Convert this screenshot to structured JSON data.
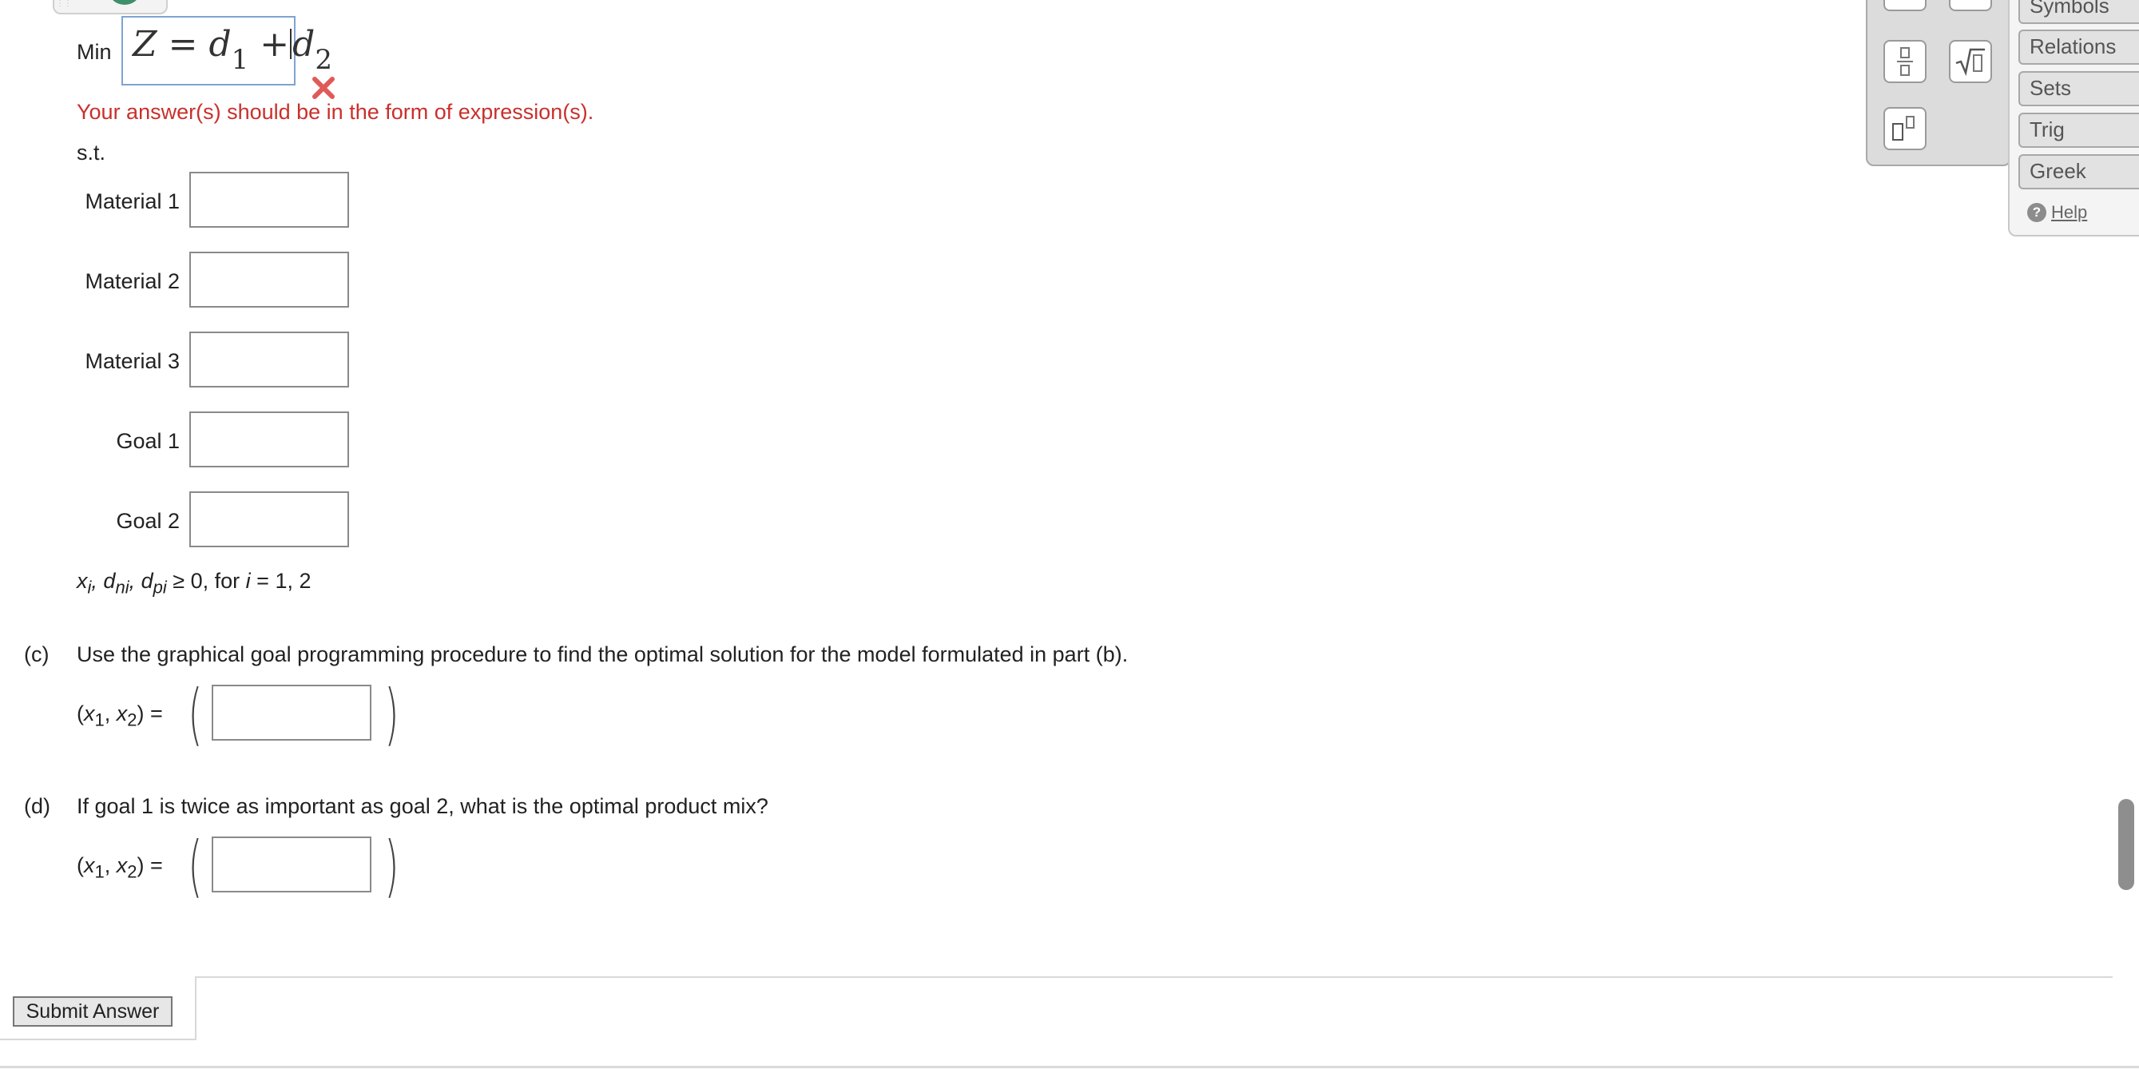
{
  "objective": {
    "label": "Min",
    "Z": "Z",
    "eq": "=",
    "d": "d",
    "sub1": "1",
    "plus": "+",
    "sub2": "2",
    "error": "Your answer(s) should be in the form of expression(s)."
  },
  "constraints": {
    "st": "s.t.",
    "rows": [
      {
        "label": "Material 1",
        "value": ""
      },
      {
        "label": "Material 2",
        "value": ""
      },
      {
        "label": "Material 3",
        "value": ""
      },
      {
        "label": "Goal 1",
        "value": ""
      },
      {
        "label": "Goal 2",
        "value": ""
      }
    ],
    "nonneg": {
      "x": "x",
      "i": "i",
      "comma": ",",
      "d": "d",
      "ni": "ni",
      "pi": "pi",
      "tail": "≥ 0, for",
      "iw": "i",
      "range": "= 1, 2"
    }
  },
  "parts": [
    {
      "letter": "(c)",
      "question": "Use the graphical goal programming procedure to find the optimal solution for the model formulated in part (b).",
      "value": ""
    },
    {
      "letter": "(d)",
      "question": "If goal 1 is twice as important as goal 2, what is the optimal product mix?",
      "value": ""
    }
  ],
  "pair": {
    "open": "(",
    "x1": "x",
    "s1": "1",
    "comma": ",",
    "x2": "x",
    "s2": "2",
    "close": ") ="
  },
  "submit_label": "Submit Answer",
  "palette": {
    "categories": [
      "Symbols",
      "Relations",
      "Sets",
      "Trig",
      "Greek"
    ],
    "help": "Help",
    "buttons": [
      "fraction-icon",
      "sqrt-icon",
      "superscript-icon"
    ]
  },
  "colors": {
    "error": "#c9302c",
    "input_focus_border": "#7fa3d2"
  }
}
